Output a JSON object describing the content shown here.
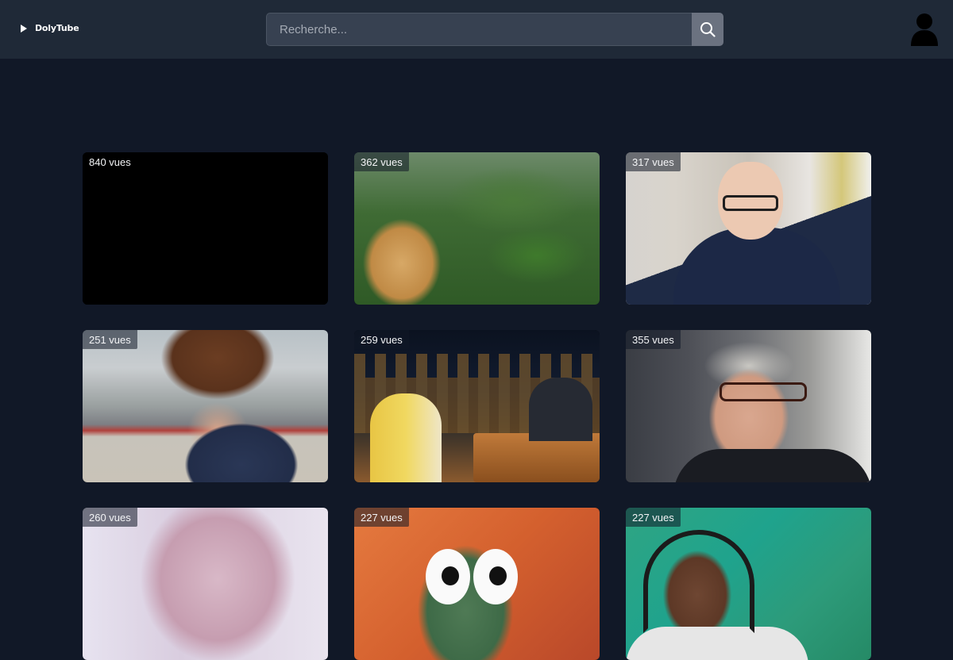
{
  "app": {
    "name": "DolyTube"
  },
  "search": {
    "placeholder": "Recherche..."
  },
  "icons": {
    "logo": "play-icon",
    "search": "search-icon",
    "account": "user-avatar-icon"
  },
  "colors": {
    "background": "#111827",
    "header": "#1f2937",
    "search_field": "#374151",
    "search_button": "#6b7280"
  },
  "videos": [
    {
      "views": "840 vues"
    },
    {
      "views": "362 vues"
    },
    {
      "views": "317 vues"
    },
    {
      "views": "251 vues"
    },
    {
      "views": "259 vues"
    },
    {
      "views": "355 vues"
    },
    {
      "views": "260 vues"
    },
    {
      "views": "227 vues"
    },
    {
      "views": "227 vues"
    }
  ]
}
